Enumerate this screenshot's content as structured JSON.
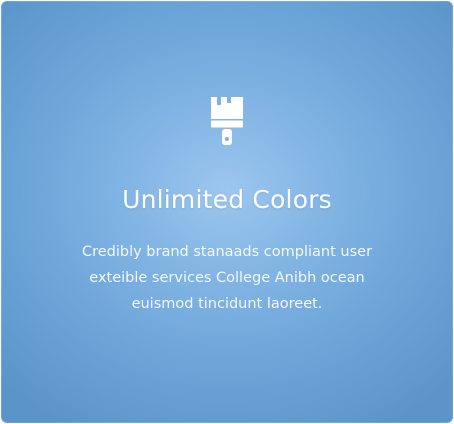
{
  "card": {
    "icon": "paintbrush-icon",
    "title": "Unlimited Colors",
    "description_lines": [
      "Credibly brand stanaads compliant user",
      "exteible services College Anibh ocean",
      "euismod tincidunt laoreet."
    ],
    "colors": {
      "background_center": "#9cc6ef",
      "background_edge": "#5b94c8",
      "text": "#ffffff"
    }
  }
}
